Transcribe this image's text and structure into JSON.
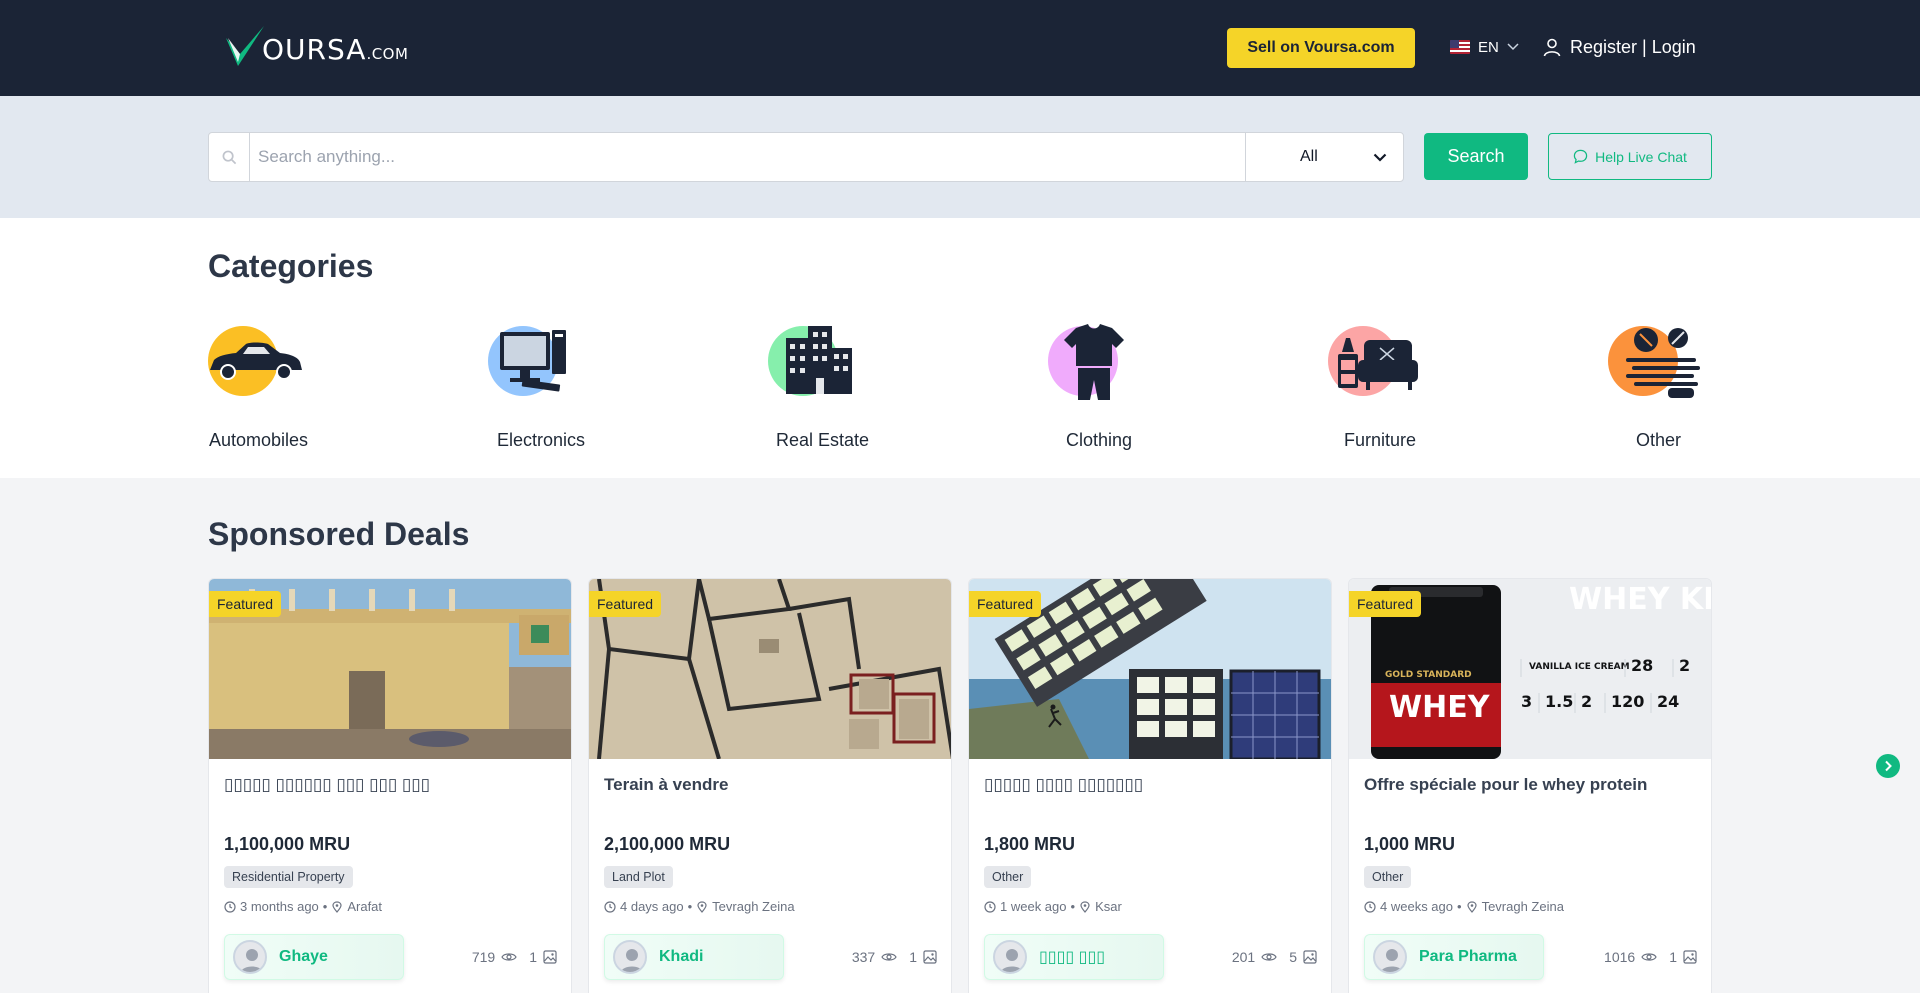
{
  "header": {
    "logo_text": "OURSA",
    "logo_suffix": ".COM",
    "sell_label": "Sell on Voursa.com",
    "language": "EN",
    "auth_label": "Register | Login"
  },
  "search": {
    "placeholder": "Search anything...",
    "category_value": "All",
    "button_label": "Search",
    "chat_label": "Help Live Chat"
  },
  "categories": {
    "title": "Categories",
    "items": [
      {
        "label": "Automobiles",
        "color": "#fbbf24"
      },
      {
        "label": "Electronics",
        "color": "#93c5fd"
      },
      {
        "label": "Real Estate",
        "color": "#86efac"
      },
      {
        "label": "Clothing",
        "color": "#f0abfc"
      },
      {
        "label": "Furniture",
        "color": "#fca5a5"
      },
      {
        "label": "Other",
        "color": "#fb923c"
      }
    ]
  },
  "sponsored": {
    "title": "Sponsored Deals",
    "cards": [
      {
        "badge": "Featured",
        "title": "▯▯▯▯▯ ▯▯▯▯▯▯ ▯▯▯ ▯▯▯ ▯▯▯",
        "price": "1,100,000 MRU",
        "tag": "Residential Property",
        "time": "3 months ago",
        "location": "Arafat",
        "seller": "Ghaye",
        "views": "719",
        "photos": "1"
      },
      {
        "badge": "Featured",
        "title": "Terain à vendre",
        "price": "2,100,000 MRU",
        "tag": "Land Plot",
        "time": "4 days ago",
        "location": "Tevragh Zeina",
        "seller": "Khadi",
        "views": "337",
        "photos": "1"
      },
      {
        "badge": "Featured",
        "title": "▯▯▯▯▯ ▯▯▯▯ ▯▯▯▯▯▯▯",
        "price": "1,800 MRU",
        "tag": "Other",
        "time": "1 week ago",
        "location": "Ksar",
        "seller": "▯▯▯▯ ▯▯▯",
        "views": "201",
        "photos": "5"
      },
      {
        "badge": "Featured",
        "title": "Offre spéciale pour le whey protein",
        "price": "1,000 MRU",
        "tag": "Other",
        "time": "4 weeks ago",
        "location": "Tevragh Zeina",
        "seller": "Para Pharma",
        "views": "1016",
        "photos": "1"
      }
    ],
    "product_brand": "WHEY",
    "product_line": "GOLD STANDARD",
    "product_flavor": "VANILLA ICE CREAM",
    "product_stats": [
      "28",
      "2",
      "3",
      "1.5",
      "2",
      "120",
      "24"
    ],
    "watermark": "WHEY KING"
  },
  "colors": {
    "header_bg": "#1b2436",
    "accent_green": "#10b981",
    "accent_yellow": "#f5d428",
    "search_band_bg": "#e2e8f0"
  }
}
